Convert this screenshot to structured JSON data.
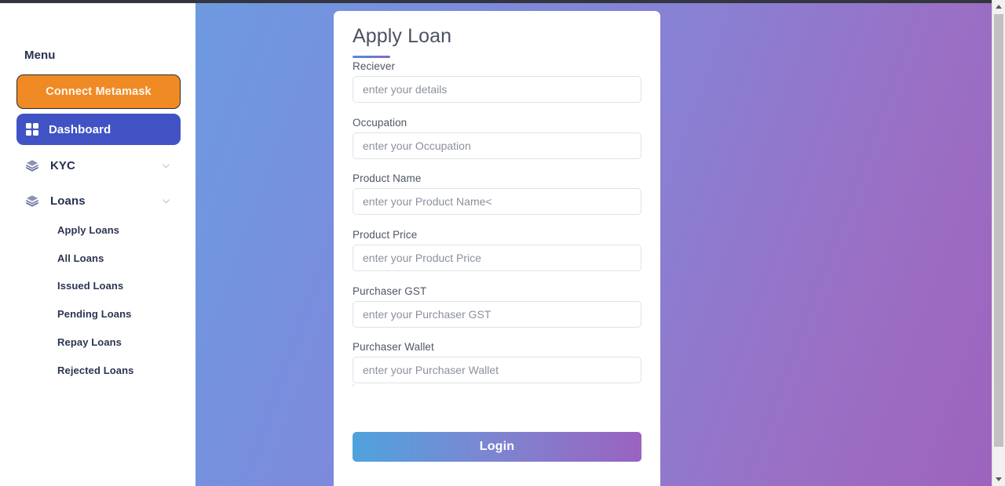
{
  "sidebar": {
    "menu_title": "Menu",
    "connect_button": "Connect Metamask",
    "dashboard": {
      "label": "Dashboard",
      "icon": "grid-icon"
    },
    "groups": [
      {
        "label": "KYC",
        "icon": "layers-icon",
        "chevron": "chevron-down-icon"
      },
      {
        "label": "Loans",
        "icon": "layers-icon",
        "chevron": "chevron-down-icon"
      }
    ],
    "loan_items": [
      {
        "label": "Apply Loans"
      },
      {
        "label": "All Loans"
      },
      {
        "label": "Issued Loans"
      },
      {
        "label": "Pending Loans"
      },
      {
        "label": "Repay Loans"
      },
      {
        "label": "Rejected Loans"
      }
    ]
  },
  "form": {
    "title": "Apply Loan",
    "fields": [
      {
        "label": "Reciever",
        "placeholder": "enter your details",
        "value": ""
      },
      {
        "label": "Occupation",
        "placeholder": "enter your Occupation",
        "value": ""
      },
      {
        "label": "Product Name",
        "placeholder": "enter your Product Name<",
        "value": ""
      },
      {
        "label": "Product Price",
        "placeholder": "enter your Product Price",
        "value": ""
      },
      {
        "label": "Purchaser GST",
        "placeholder": "enter your Purchaser GST",
        "value": ""
      },
      {
        "label": "Purchaser Wallet",
        "placeholder": "enter your Purchaser Wallet",
        "value": ""
      }
    ],
    "stray_mark": "'",
    "submit_label": "Login"
  },
  "scrollbar": {
    "up_arrow": "scroll-up-arrow",
    "down_arrow": "scroll-down-arrow"
  },
  "colors": {
    "metamask_orange": "#f08a24",
    "dashboard_blue": "#4153c4",
    "sidebar_text": "#27314e",
    "gradient_start": "#6d9ae0",
    "gradient_end": "#9d63bd",
    "login_gradient_start": "#4fa3dd",
    "login_gradient_end": "#9a63c0"
  }
}
